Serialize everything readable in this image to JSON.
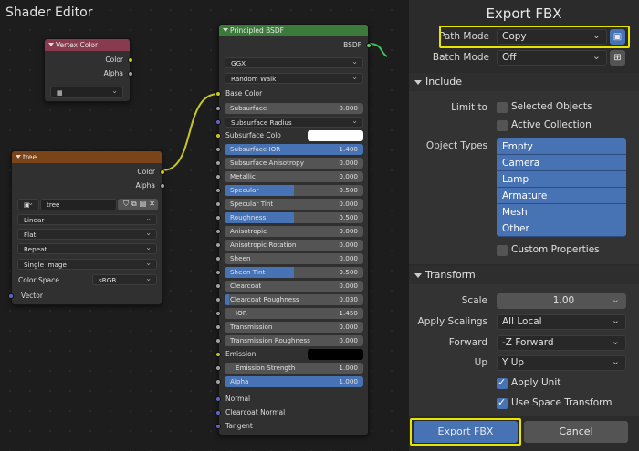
{
  "editor": {
    "title": "Shader Editor"
  },
  "vertex_color": {
    "title": "Vertex Color",
    "out_color": "Color",
    "out_alpha": "Alpha"
  },
  "tree_node": {
    "title": "tree",
    "out_color": "Color",
    "out_alpha": "Alpha",
    "image_name": "tree",
    "interpolation": "Linear",
    "projection": "Flat",
    "extension": "Repeat",
    "source": "Single Image",
    "color_space_label": "Color Space",
    "color_space": "sRGB",
    "in_vector": "Vector"
  },
  "bsdf": {
    "title": "Principled BSDF",
    "out": "BSDF",
    "distribution": "GGX",
    "subsurface_method": "Random Walk",
    "base_color": "Base Color",
    "rows": [
      {
        "label": "Subsurface",
        "value": "0.000",
        "fill": 0
      },
      {
        "label": "Subsurface Radius",
        "value": "",
        "dd": true
      },
      {
        "label": "Subsurface Colo",
        "value": "",
        "swatch": "#ffffff"
      },
      {
        "label": "Subsurface IOR",
        "value": "1.400",
        "fill": 1
      },
      {
        "label": "Subsurface Anisotropy",
        "value": "0.000",
        "fill": 0
      },
      {
        "label": "Metallic",
        "value": "0.000",
        "fill": 0
      },
      {
        "label": "Specular",
        "value": "0.500",
        "fill": 0.5
      },
      {
        "label": "Specular Tint",
        "value": "0.000",
        "fill": 0
      },
      {
        "label": "Roughness",
        "value": "0.500",
        "fill": 0.5
      },
      {
        "label": "Anisotropic",
        "value": "0.000",
        "fill": 0
      },
      {
        "label": "Anisotropic Rotation",
        "value": "0.000",
        "fill": 0
      },
      {
        "label": "Sheen",
        "value": "0.000",
        "fill": 0
      },
      {
        "label": "Sheen Tint",
        "value": "0.500",
        "fill": 0.5
      },
      {
        "label": "Clearcoat",
        "value": "0.000",
        "fill": 0
      },
      {
        "label": "Clearcoat Roughness",
        "value": "0.030",
        "fill": 0.03
      },
      {
        "label": "IOR",
        "value": "1.450",
        "fill": 0
      },
      {
        "label": "Transmission",
        "value": "0.000",
        "fill": 0
      },
      {
        "label": "Transmission Roughness",
        "value": "0.000",
        "fill": 0
      },
      {
        "label": "Emission",
        "value": "",
        "swatch": "#000000"
      },
      {
        "label": "Emission Strength",
        "value": "1.000",
        "fill": 0
      },
      {
        "label": "Alpha",
        "value": "1.000",
        "fill": 1
      }
    ],
    "normal": "Normal",
    "clearcoat_normal": "Clearcoat Normal",
    "tangent": "Tangent"
  },
  "fbx": {
    "title": "Export FBX",
    "path_mode_label": "Path Mode",
    "path_mode": "Copy",
    "batch_mode_label": "Batch Mode",
    "batch_mode": "Off",
    "include_title": "Include",
    "limit_to_label": "Limit to",
    "selected_objects": "Selected Objects",
    "active_collection": "Active Collection",
    "object_types_label": "Object Types",
    "object_types": [
      "Empty",
      "Camera",
      "Lamp",
      "Armature",
      "Mesh",
      "Other"
    ],
    "custom_properties": "Custom Properties",
    "transform_title": "Transform",
    "scale_label": "Scale",
    "scale": "1.00",
    "apply_scalings_label": "Apply Scalings",
    "apply_scalings": "All Local",
    "forward_label": "Forward",
    "forward": "-Z Forward",
    "up_label": "Up",
    "up": "Y Up",
    "apply_unit": "Apply Unit",
    "use_space_transform": "Use Space Transform",
    "export_button": "Export FBX",
    "cancel_button": "Cancel"
  },
  "colors": {
    "accent": "#4772b3",
    "highlight": "#e5e500",
    "vertex_header": "#883a4e",
    "texture_header": "#7a4418",
    "shader_header": "#3b7a3b"
  }
}
